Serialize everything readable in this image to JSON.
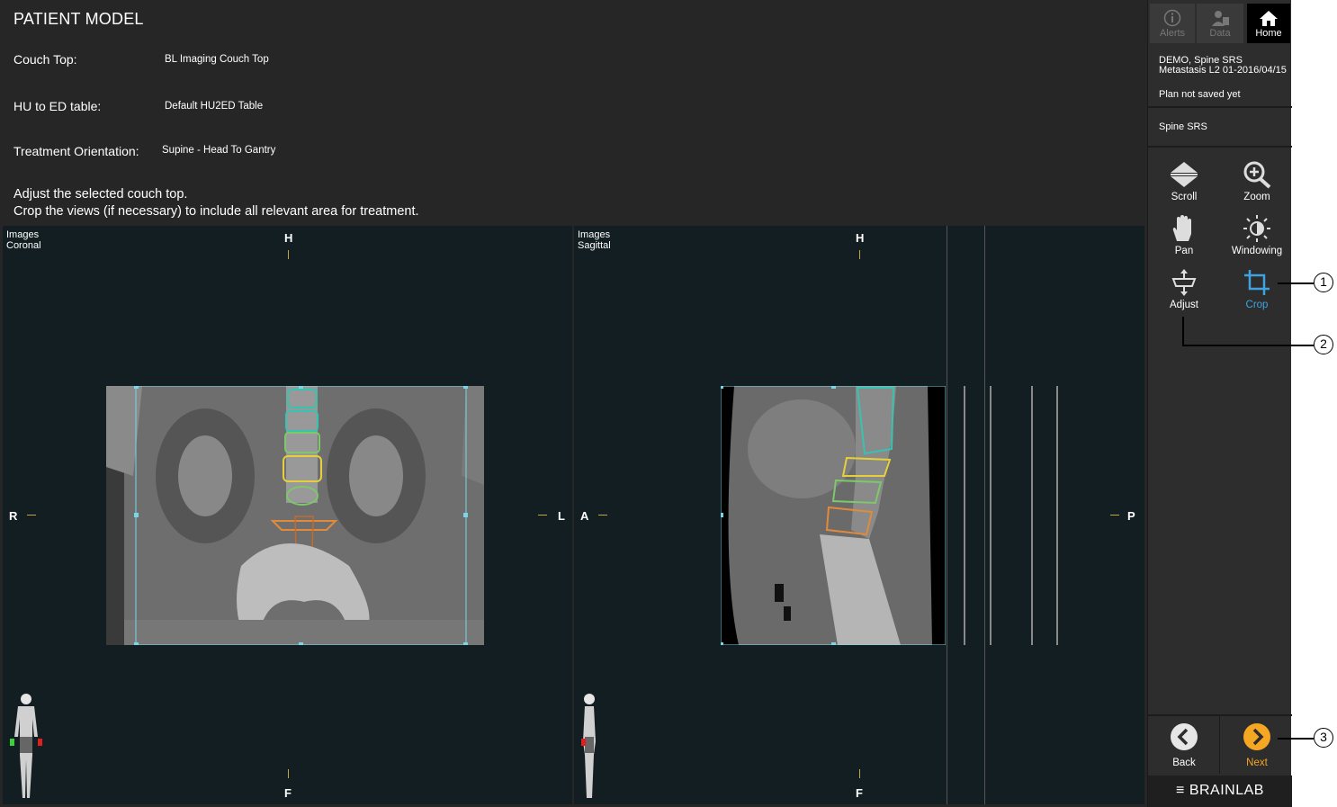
{
  "header": {
    "title": "PATIENT MODEL",
    "couch_top_label": "Couch Top:",
    "couch_top_value": "BL Imaging Couch Top",
    "hu_label": "HU to ED table:",
    "hu_value": "Default HU2ED Table",
    "orientation_label": "Treatment Orientation:",
    "orientation_value": "Supine - Head To Gantry",
    "instruction_1": "Adjust the selected couch top.",
    "instruction_2": "Crop the views (if necessary) to include all relevant area for treatment."
  },
  "coronal_view": {
    "label_1": "Images",
    "label_2": "Coronal",
    "top": "H",
    "bottom": "F",
    "left": "R",
    "right": "L"
  },
  "sagittal_view": {
    "label_1": "Images",
    "label_2": "Sagittal",
    "top": "H",
    "bottom": "F",
    "left": "A",
    "right": "P"
  },
  "sidebar": {
    "alerts_label": "Alerts",
    "data_label": "Data",
    "home_label": "Home",
    "patient_line_1": "DEMO, Spine SRS",
    "patient_line_2": "Metastasis L2 01-2016/04/15",
    "plan_status": "Plan not saved yet",
    "plan_name": "Spine SRS",
    "tools": {
      "scroll": "Scroll",
      "zoom": "Zoom",
      "pan": "Pan",
      "windowing": "Windowing",
      "adjust": "Adjust",
      "crop": "Crop"
    },
    "back_label": "Back",
    "next_label": "Next",
    "brand": "BRAINLAB"
  },
  "callouts": {
    "one": "1",
    "two": "2",
    "three": "3"
  },
  "colors": {
    "accent_blue": "#3ea3e0",
    "next_orange": "#f5a623",
    "crop_frame": "#7ad6e6"
  }
}
